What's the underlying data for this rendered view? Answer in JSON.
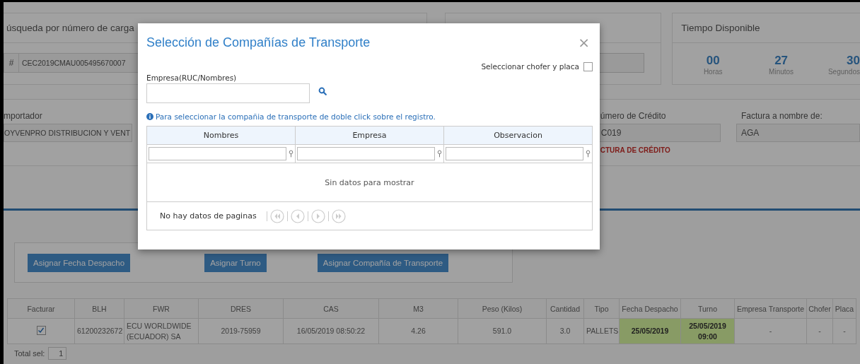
{
  "search_panel": {
    "title": "úsqueda por número de carga",
    "prefix": "#",
    "value": "CEC2019CMAU005495670007"
  },
  "timer": {
    "title": "Tiempo Disponible",
    "units": [
      {
        "value": "00",
        "label": "Horas"
      },
      {
        "value": "27",
        "label": "Minutos"
      },
      {
        "value": "30",
        "label": "Segundos"
      }
    ]
  },
  "importer": {
    "label": "mportador",
    "value": "OYVENPRO DISTRIBUCION Y VENT"
  },
  "credit": {
    "label": "úmero de Crédito",
    "value": "C019",
    "warning": "CTURA DE CRÉDITO"
  },
  "invoice_to": {
    "label": "Factura a nombre de:",
    "value": "AGA"
  },
  "actions": [
    "Asignar Fecha Despacho",
    "Asignar Turno",
    "Asignar Compañía de Transporte"
  ],
  "table": {
    "columns": [
      "Facturar",
      "BLH",
      "FWR",
      "DRES",
      "CAS",
      "M3",
      "Peso (Kilos)",
      "Cantidad",
      "Tipo",
      "Fecha Despacho",
      "Turno",
      "Empresa Transporte",
      "Chofer",
      "Placa"
    ],
    "rows": [
      {
        "cells": [
          {
            "kind": "checkbox",
            "checked": true
          },
          {
            "text": "61200232672",
            "highlighted": false
          },
          {
            "text": "ECU WORLDWIDE (ECUADOR) SA",
            "highlighted": false
          },
          {
            "text": "2019-75959",
            "highlighted": false
          },
          {
            "text": "16/05/2019 08:50:22",
            "highlighted": false
          },
          {
            "text": "4.26",
            "highlighted": false
          },
          {
            "text": "591.0",
            "highlighted": false
          },
          {
            "text": "3.0",
            "highlighted": false
          },
          {
            "text": "PALLETS",
            "highlighted": false
          },
          {
            "text": "25/05/2019",
            "highlighted": true
          },
          {
            "text": "25/05/2019 09:00",
            "highlighted": true
          },
          {
            "text": "-",
            "highlighted": false
          },
          {
            "text": "-",
            "highlighted": false
          },
          {
            "text": "-",
            "highlighted": false
          }
        ]
      }
    ]
  },
  "total": {
    "label": "Total sel:",
    "value": "1"
  },
  "dialog": {
    "title": "Selección de Compañías de Transporte",
    "close": "×",
    "driver_toggle": {
      "label": "Seleccionar chofer y placa",
      "checked": false
    },
    "company_field": {
      "label": "Empresa(RUC/Nombres)"
    },
    "hint": "Para seleccionar la compañia de transporte de doble click sobre el registro.",
    "grid": {
      "columns": [
        "Nombres",
        "Empresa",
        "Observacion"
      ],
      "empty_text": "Sin datos para mostrar",
      "pager_text": "No hay datos de paginas"
    }
  }
}
